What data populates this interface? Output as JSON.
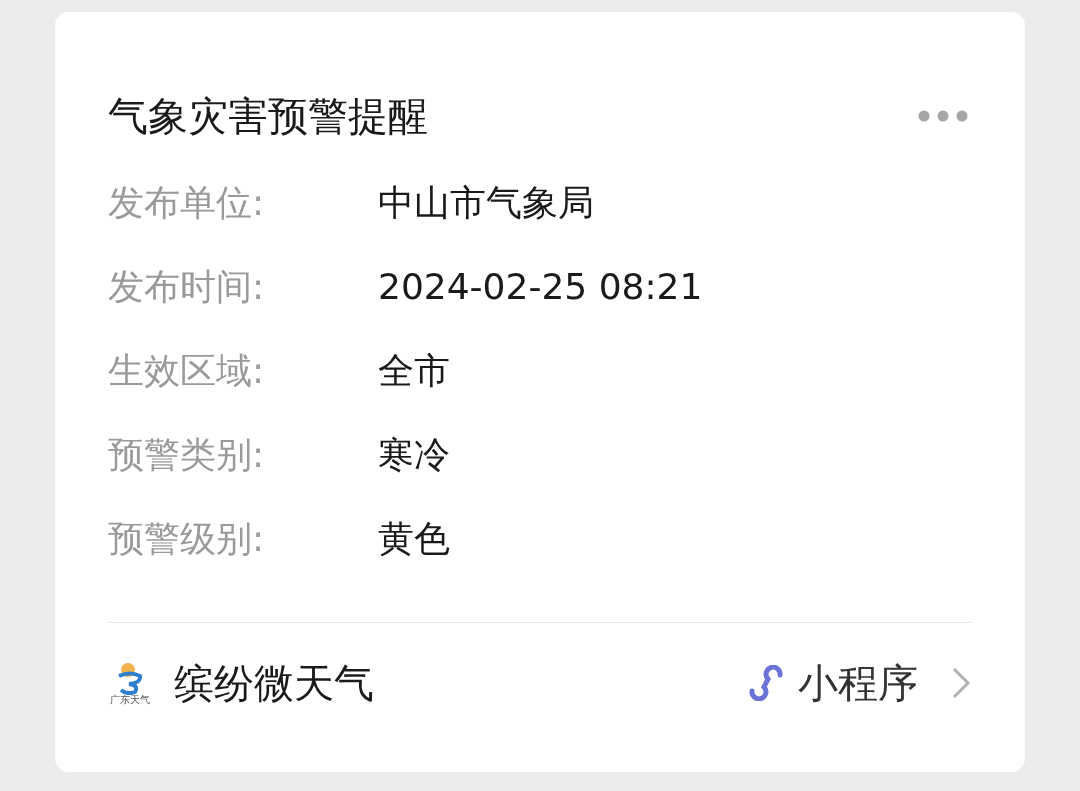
{
  "card": {
    "title": "气象灾害预警提醒",
    "fields": [
      {
        "label": "发布单位:",
        "value": "中山市气象局"
      },
      {
        "label": "发布时间:",
        "value": "2024-02-25 08:21"
      },
      {
        "label": "生效区域:",
        "value": "全市"
      },
      {
        "label": "预警类别:",
        "value": "寒冷"
      },
      {
        "label": "预警级别:",
        "value": "黄色"
      }
    ],
    "footer": {
      "logo_caption": "广东天气",
      "app_name": "缤纷微天气",
      "badge": "小程序"
    }
  }
}
